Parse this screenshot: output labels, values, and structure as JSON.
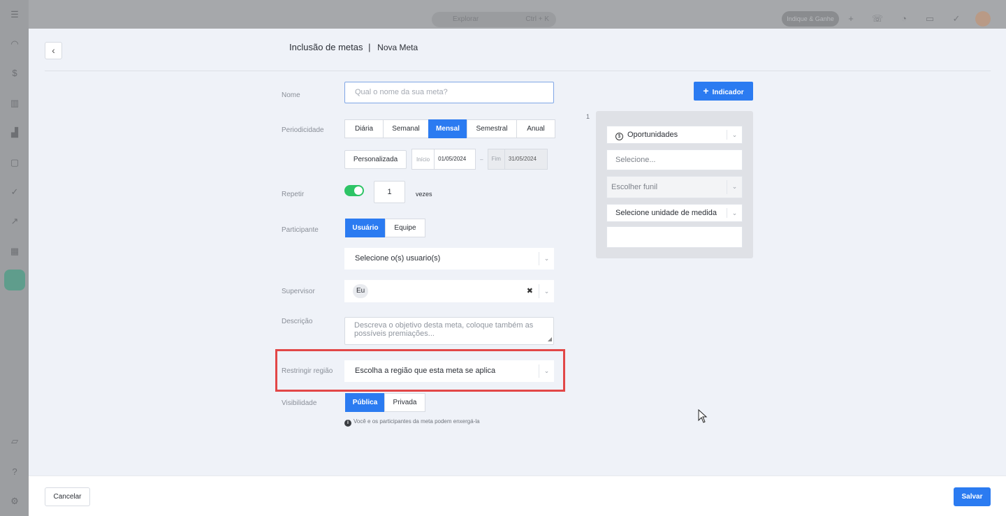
{
  "app": {
    "search_placeholder": "Explorar",
    "search_shortcut": "Ctrl + K",
    "indique_label": "Indique & Ganhe"
  },
  "header": {
    "title": "Inclusão de metas",
    "separator": "|",
    "subtitle": "Nova Meta"
  },
  "form": {
    "nome": {
      "label": "Nome",
      "placeholder": "Qual o nome da sua meta?"
    },
    "periodicidade": {
      "label": "Periodicidade",
      "options": [
        "Diária",
        "Semanal",
        "Mensal",
        "Semestral",
        "Anual"
      ],
      "selected": "Mensal",
      "custom_label": "Personalizada",
      "start_label": "Início",
      "start_value": "01/05/2024",
      "range_sep": "–",
      "end_label": "Fim",
      "end_value": "31/05/2024"
    },
    "repetir": {
      "label": "Repetir",
      "enabled": true,
      "value": "1",
      "unit": "vezes"
    },
    "participante": {
      "label": "Participante",
      "options": [
        "Usuário",
        "Equipe"
      ],
      "selected": "Usuário",
      "select_placeholder": "Selecione o(s) usuario(s)"
    },
    "supervisor": {
      "label": "Supervisor",
      "value": "Eu",
      "clear_icon": "close-icon"
    },
    "descricao": {
      "label": "Descrição",
      "placeholder_line1": "Descreva o objetivo desta meta, coloque também as",
      "placeholder_line2": "possíveis premiações..."
    },
    "regiao": {
      "label": "Restringir região",
      "placeholder": "Escolha a região que esta meta se aplica"
    },
    "visibilidade": {
      "label": "Visibilidade",
      "options": [
        "Pública",
        "Privada"
      ],
      "selected": "Pública",
      "hint": "Você e os participantes da meta podem enxergá-la"
    }
  },
  "indicator": {
    "button_label": "Indicador",
    "index": "1",
    "type_value": "Oportunidades",
    "select_placeholder": "Selecione...",
    "funnel_placeholder": "Escolher funil",
    "unit_placeholder": "Selecione unidade de medida",
    "value_input": ""
  },
  "footer": {
    "cancel_label": "Cancelar",
    "save_label": "Salvar"
  },
  "colors": {
    "primary": "#2b7bf1",
    "toggle_on": "#2ec466",
    "highlight": "#e24747"
  }
}
